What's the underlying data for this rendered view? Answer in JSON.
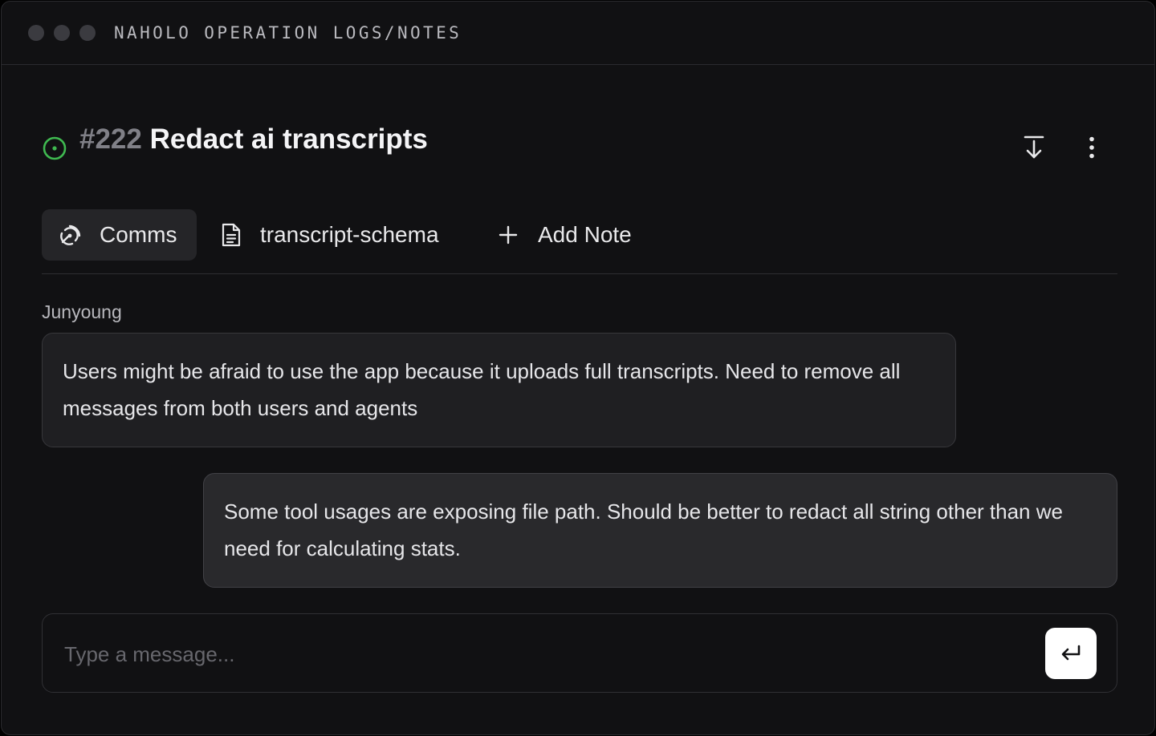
{
  "window": {
    "title": "NAHOLO OPERATION LOGS/NOTES"
  },
  "issue": {
    "number": "#222",
    "title": "Redact ai transcripts",
    "status_icon": "open-circle-icon",
    "status_color": "#3fb950",
    "actions": [
      "download-icon",
      "more-vertical-icon"
    ]
  },
  "tabs": [
    {
      "label": "Comms",
      "icon": "broadcast-icon",
      "active": true
    },
    {
      "label": "transcript-schema",
      "icon": "document-icon",
      "active": false
    },
    {
      "label": "Add Note",
      "icon": "plus-icon",
      "active": false
    }
  ],
  "messages": [
    {
      "author": "Junyoung",
      "text": "Users might be afraid to use the app because it uploads full transcripts. Need to remove all messages from both users and agents",
      "side": "left"
    },
    {
      "author": "",
      "text": "Some tool usages are exposing file path. Should be better to redact all string other than we need for calculating stats.",
      "side": "right"
    }
  ],
  "composer": {
    "placeholder": "Type a message...",
    "value": "",
    "send_icon": "enter-icon"
  }
}
